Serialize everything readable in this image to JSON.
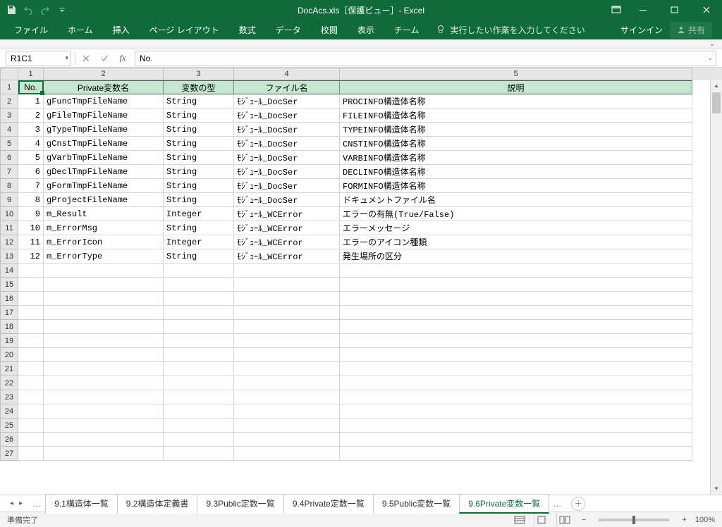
{
  "window": {
    "title": "DocAcs.xls［保護ビュー］- Excel"
  },
  "ribbon": {
    "tabs": [
      "ファイル",
      "ホーム",
      "挿入",
      "ページ レイアウト",
      "数式",
      "データ",
      "校閲",
      "表示",
      "チーム"
    ],
    "tellme": "実行したい作業を入力してください",
    "signin": "サインイン",
    "share": "共有"
  },
  "formula": {
    "namebox": "R1C1",
    "fx_label": "fx",
    "value": "No."
  },
  "col_headers": [
    "1",
    "2",
    "3",
    "4",
    "5"
  ],
  "row_headers": [
    "1",
    "2",
    "3",
    "4",
    "5",
    "6",
    "7",
    "8",
    "9",
    "10",
    "11",
    "12",
    "13",
    "14",
    "15",
    "16",
    "17",
    "18",
    "19",
    "20",
    "21",
    "22",
    "23",
    "24",
    "25",
    "26",
    "27"
  ],
  "header_row": [
    "No.",
    "Private変数名",
    "変数の型",
    "ファイル名",
    "説明"
  ],
  "rows": [
    [
      "1",
      "gFuncTmpFileName",
      "String",
      "ﾓｼﾞｭｰﾙ_DocSer",
      "PROCINFO構造体名称"
    ],
    [
      "2",
      "gFileTmpFileName",
      "String",
      "ﾓｼﾞｭｰﾙ_DocSer",
      "FILEINFO構造体名称"
    ],
    [
      "3",
      "gTypeTmpFileName",
      "String",
      "ﾓｼﾞｭｰﾙ_DocSer",
      "TYPEINFO構造体名称"
    ],
    [
      "4",
      "gCnstTmpFileName",
      "String",
      "ﾓｼﾞｭｰﾙ_DocSer",
      "CNSTINFO構造体名称"
    ],
    [
      "5",
      "gVarbTmpFileName",
      "String",
      "ﾓｼﾞｭｰﾙ_DocSer",
      "VARBINFO構造体名称"
    ],
    [
      "6",
      "gDeclTmpFileName",
      "String",
      "ﾓｼﾞｭｰﾙ_DocSer",
      "DECLINFO構造体名称"
    ],
    [
      "7",
      "gFormTmpFileName",
      "String",
      "ﾓｼﾞｭｰﾙ_DocSer",
      "FORMINFO構造体名称"
    ],
    [
      "8",
      "gProjectFileName",
      "String",
      "ﾓｼﾞｭｰﾙ_DocSer",
      "ドキュメントファイル名"
    ],
    [
      "9",
      "m_Result",
      "Integer",
      "ﾓｼﾞｭｰﾙ_WCError",
      "エラーの有無(True/False)"
    ],
    [
      "10",
      "m_ErrorMsg",
      "String",
      "ﾓｼﾞｭｰﾙ_WCError",
      "エラーメッセージ"
    ],
    [
      "11",
      "m_ErrorIcon",
      "Integer",
      "ﾓｼﾞｭｰﾙ_WCError",
      "エラーのアイコン種類"
    ],
    [
      "12",
      "m_ErrorType",
      "String",
      "ﾓｼﾞｭｰﾙ_WCError",
      "発生場所の区分"
    ]
  ],
  "sheet_tabs": [
    "9.1構造体一覧",
    "9.2構造体定義書",
    "9.3Public定数一覧",
    "9.4Private定数一覧",
    "9.5Public変数一覧",
    "9.6Private変数一覧"
  ],
  "active_tab_index": 5,
  "status": {
    "ready": "準備完了",
    "zoom": "100%"
  }
}
